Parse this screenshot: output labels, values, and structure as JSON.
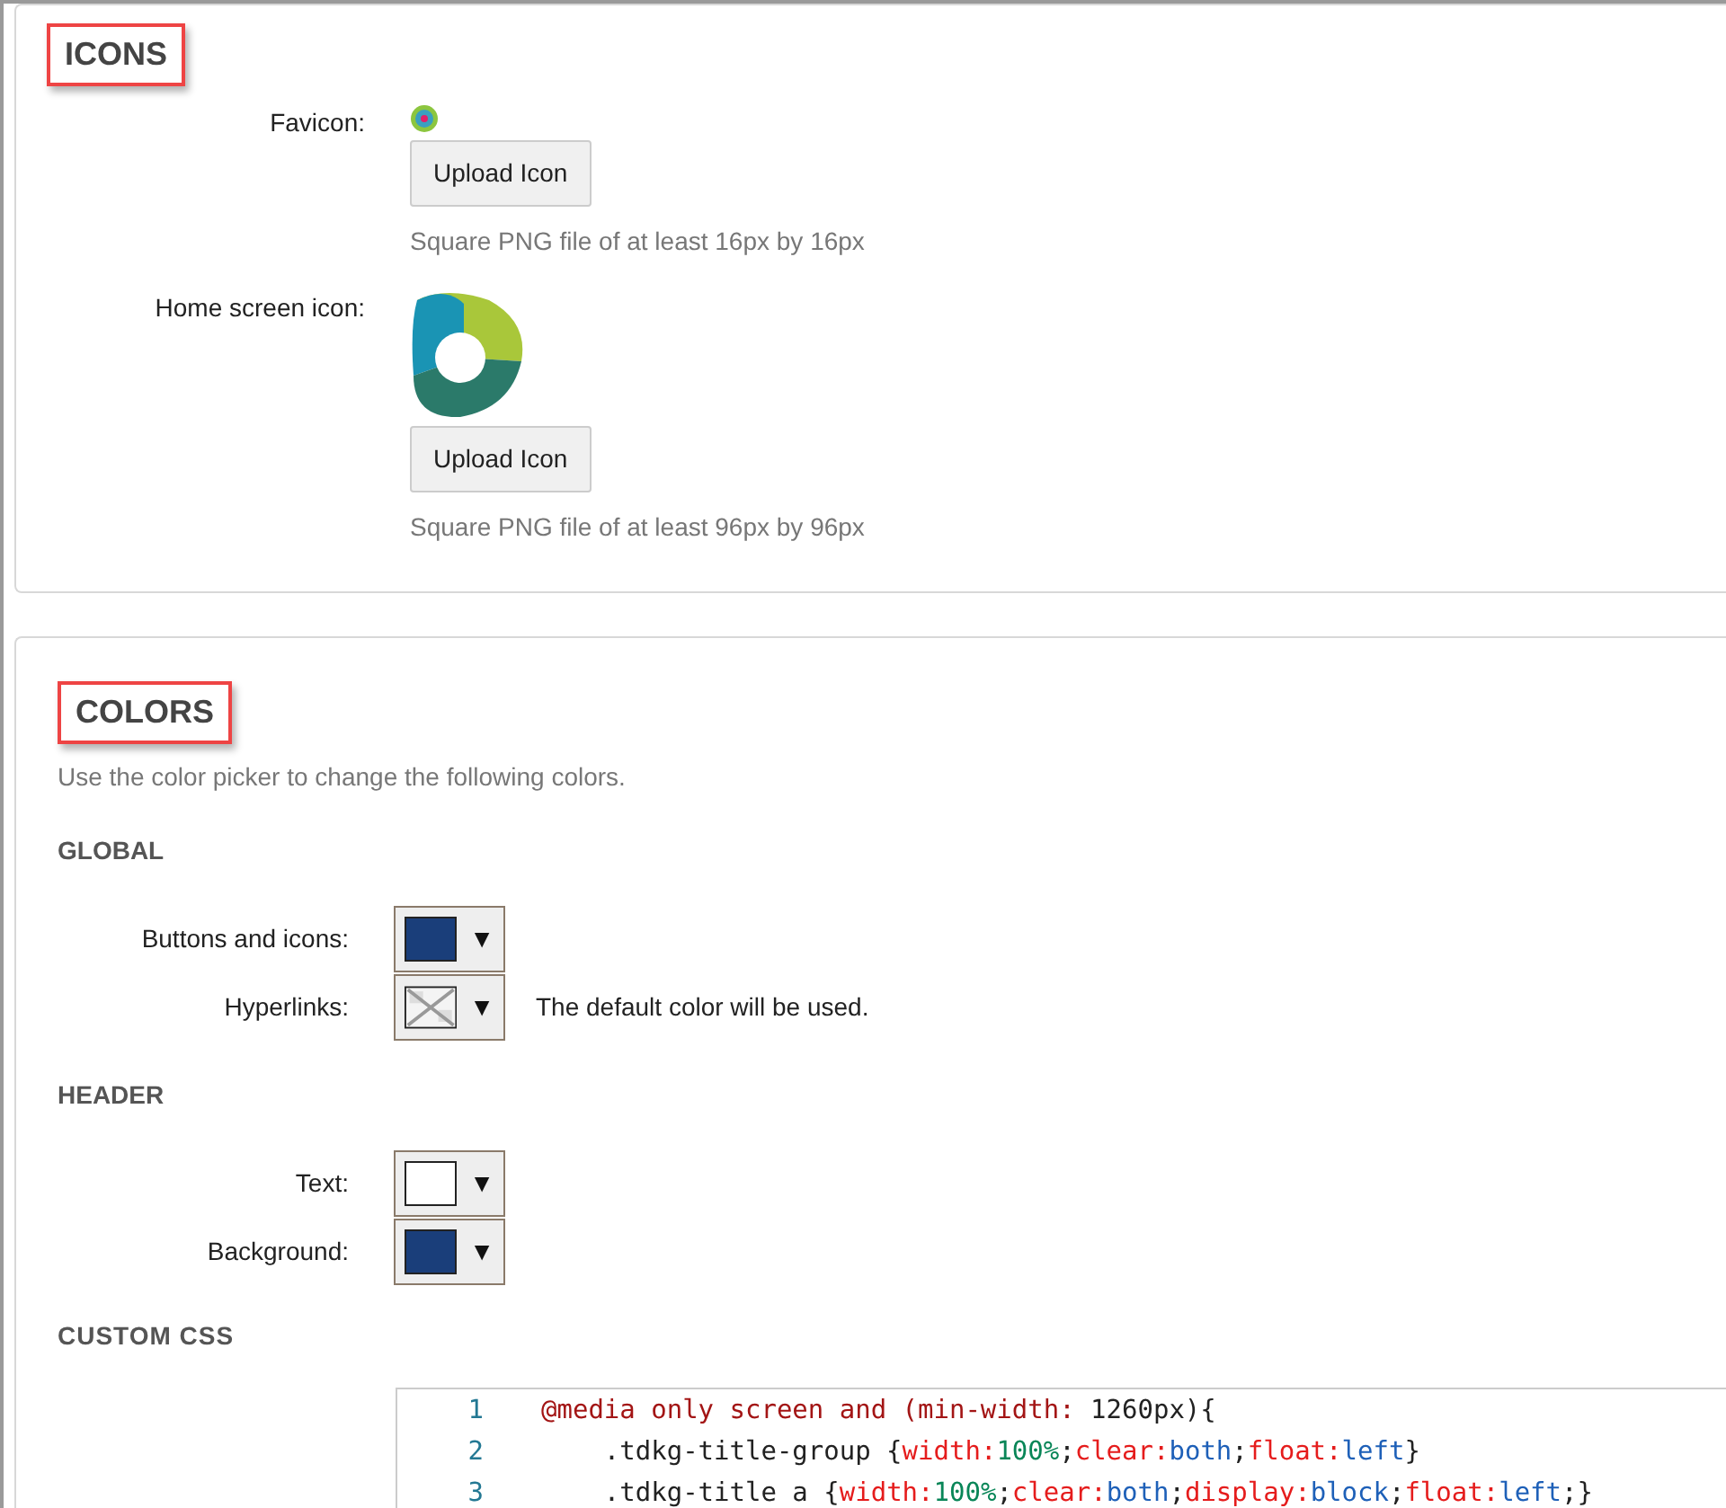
{
  "icons_section": {
    "heading": "ICONS",
    "fields": [
      {
        "label": "Favicon:",
        "kind": "favicon",
        "button": "Upload Icon",
        "hint": "Square PNG file of at least 16px by 16px"
      },
      {
        "label": "Home screen icon:",
        "kind": "home",
        "button": "Upload Icon",
        "hint": "Square PNG file of at least 96px by 96px"
      }
    ]
  },
  "colors_section": {
    "heading": "COLORS",
    "description": "Use the color picker to change the following colors.",
    "groups": [
      {
        "title": "GLOBAL",
        "pickers": [
          {
            "label": "Buttons and icons:",
            "kind": "color",
            "color": "#1a3e7a",
            "caret": "▼"
          },
          {
            "label": "Hyperlinks:",
            "kind": "none",
            "caret": "▼",
            "note": "The default color will be used."
          }
        ]
      },
      {
        "title": "HEADER",
        "pickers": [
          {
            "label": "Text:",
            "kind": "color",
            "color": "#ffffff",
            "caret": "▼"
          },
          {
            "label": "Background:",
            "kind": "color",
            "color": "#1a3e7a",
            "caret": "▼"
          }
        ]
      }
    ],
    "custom_css": {
      "title": "CUSTOM CSS",
      "lines": [
        {
          "number": "1",
          "tokens": [
            {
              "kind": "keyword",
              "text": "@media only screen and (min-width:"
            },
            {
              "kind": "plain",
              "text": " 1260px){"
            }
          ]
        },
        {
          "number": "2",
          "tokens": [
            {
              "kind": "plain",
              "text": "    .tdkg-title-group {"
            },
            {
              "kind": "property",
              "text": "width:"
            },
            {
              "kind": "number",
              "text": "100%"
            },
            {
              "kind": "plain",
              "text": ";"
            },
            {
              "kind": "property",
              "text": "clear:"
            },
            {
              "kind": "value",
              "text": "both"
            },
            {
              "kind": "plain",
              "text": ";"
            },
            {
              "kind": "property",
              "text": "float:"
            },
            {
              "kind": "value",
              "text": "left"
            },
            {
              "kind": "plain",
              "text": "}"
            }
          ]
        },
        {
          "number": "3",
          "tokens": [
            {
              "kind": "plain",
              "text": "    .tdkg-title a {"
            },
            {
              "kind": "property",
              "text": "width:"
            },
            {
              "kind": "number",
              "text": "100%"
            },
            {
              "kind": "plain",
              "text": ";"
            },
            {
              "kind": "property",
              "text": "clear:"
            },
            {
              "kind": "value",
              "text": "both"
            },
            {
              "kind": "plain",
              "text": ";"
            },
            {
              "kind": "property",
              "text": "display:"
            },
            {
              "kind": "value",
              "text": "block"
            },
            {
              "kind": "plain",
              "text": ";"
            },
            {
              "kind": "property",
              "text": "float:"
            },
            {
              "kind": "value",
              "text": "left"
            },
            {
              "kind": "plain",
              "text": ";}"
            }
          ]
        }
      ]
    }
  }
}
